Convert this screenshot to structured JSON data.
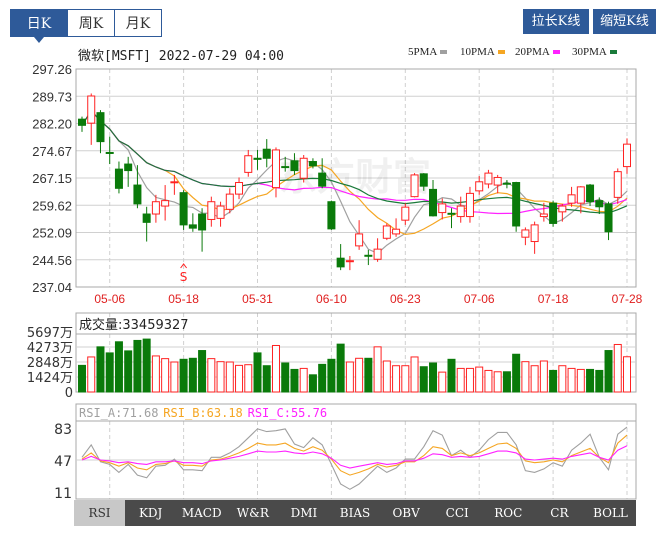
{
  "period_tabs": [
    {
      "label": "日K",
      "active": true
    },
    {
      "label": "周K",
      "active": false
    },
    {
      "label": "月K",
      "active": false
    }
  ],
  "buttons": {
    "stretch": "拉长K线",
    "shrink": "缩短K线"
  },
  "title": "微软[MSFT] 2022-07-29 04:00",
  "watermark": "东方财富",
  "legend": [
    {
      "label": "5PMA",
      "color": "#a0a0a0"
    },
    {
      "label": "10PMA",
      "color": "#f5a623"
    },
    {
      "label": "20PMA",
      "color": "#ff22ff"
    },
    {
      "label": "30PMA",
      "color": "#1a7a3a"
    }
  ],
  "colors": {
    "up": "#ff2222",
    "down": "#0a7a0a",
    "grid": "#d0d0d0",
    "frame": "#a8a8a8",
    "axis_text": "#333333",
    "date_text": "#e02020"
  },
  "signal": {
    "label": "S",
    "index": 11
  },
  "chart_data": [
    {
      "type": "candlestick",
      "title": "微软[MSFT] 2022-07-29 04:00",
      "ylim": [
        237.04,
        297.26
      ],
      "yticks": [
        "297.26",
        "289.73",
        "282.20",
        "274.67",
        "267.15",
        "259.62",
        "252.09",
        "244.56",
        "237.04"
      ],
      "xticks": [
        {
          "label": "05-06",
          "index": 3
        },
        {
          "label": "05-18",
          "index": 11
        },
        {
          "label": "05-31",
          "index": 19
        },
        {
          "label": "06-10",
          "index": 27
        },
        {
          "label": "06-23",
          "index": 35
        },
        {
          "label": "07-06",
          "index": 43
        },
        {
          "label": "07-18",
          "index": 51
        },
        {
          "label": "07-28",
          "index": 59
        }
      ],
      "ma_periods": [
        5,
        10,
        20,
        30
      ],
      "ohlc": [
        [
          283.4,
          284.1,
          279.9,
          281.7
        ],
        [
          282.3,
          290.5,
          276.3,
          289.8
        ],
        [
          285.2,
          285.9,
          274.0,
          277.2
        ],
        [
          274.2,
          278.6,
          271.0,
          274.0
        ],
        [
          269.6,
          271.7,
          262.9,
          264.3
        ],
        [
          271.0,
          273.0,
          264.7,
          269.2
        ],
        [
          265.2,
          270.7,
          258.8,
          260.0
        ],
        [
          257.2,
          259.2,
          249.6,
          254.9
        ],
        [
          257.2,
          262.5,
          254.8,
          260.6
        ],
        [
          259.4,
          265.2,
          255.4,
          260.9
        ],
        [
          265.9,
          268.0,
          262.5,
          266.1
        ],
        [
          263.1,
          263.8,
          252.8,
          254.2
        ],
        [
          254.2,
          257.4,
          252.3,
          253.3
        ],
        [
          257.2,
          258.8,
          246.8,
          252.8
        ],
        [
          255.7,
          262.0,
          253.7,
          260.6
        ],
        [
          256.0,
          260.6,
          253.7,
          259.4
        ],
        [
          258.5,
          264.3,
          257.4,
          262.7
        ],
        [
          262.7,
          267.3,
          261.3,
          265.9
        ],
        [
          268.7,
          274.9,
          267.5,
          273.3
        ],
        [
          272.6,
          274.9,
          269.4,
          272.3
        ],
        [
          275.1,
          277.9,
          270.1,
          272.6
        ],
        [
          264.5,
          275.6,
          261.8,
          274.9
        ],
        [
          270.3,
          273.0,
          268.9,
          270.1
        ],
        [
          271.9,
          274.0,
          268.0,
          269.2
        ],
        [
          267.1,
          273.5,
          265.9,
          272.6
        ],
        [
          271.7,
          272.6,
          269.8,
          270.5
        ],
        [
          268.5,
          272.6,
          264.3,
          264.9
        ],
        [
          260.6,
          260.9,
          252.8,
          253.1
        ],
        [
          245.0,
          248.9,
          241.7,
          242.6
        ],
        [
          244.1,
          245.6,
          241.7,
          244.3
        ],
        [
          248.4,
          255.5,
          247.3,
          251.7
        ],
        [
          245.8,
          247.3,
          243.1,
          245.6
        ],
        [
          244.7,
          250.5,
          244.0,
          247.5
        ],
        [
          250.5,
          254.6,
          250.0,
          253.9
        ],
        [
          251.7,
          256.0,
          250.9,
          253.0
        ],
        [
          255.5,
          260.2,
          254.2,
          259.1
        ],
        [
          262.0,
          268.5,
          261.8,
          268.0
        ],
        [
          268.3,
          268.5,
          263.6,
          264.9
        ],
        [
          264.0,
          266.6,
          256.5,
          256.7
        ],
        [
          257.6,
          261.5,
          255.7,
          260.0
        ],
        [
          257.4,
          258.8,
          253.3,
          257.2
        ],
        [
          256.5,
          262.0,
          254.8,
          259.4
        ],
        [
          256.5,
          264.7,
          254.8,
          262.9
        ],
        [
          263.6,
          267.7,
          262.5,
          266.1
        ],
        [
          265.5,
          269.4,
          264.3,
          268.5
        ],
        [
          265.2,
          268.0,
          262.9,
          267.3
        ],
        [
          265.7,
          266.6,
          264.3,
          265.5
        ],
        [
          265.9,
          266.1,
          252.3,
          253.9
        ],
        [
          250.8,
          253.5,
          248.6,
          252.8
        ],
        [
          249.6,
          255.1,
          246.2,
          254.2
        ],
        [
          256.5,
          260.3,
          255.1,
          257.2
        ],
        [
          260.2,
          260.9,
          253.7,
          254.6
        ],
        [
          257.8,
          260.0,
          255.1,
          259.4
        ],
        [
          260.2,
          264.7,
          259.2,
          262.5
        ],
        [
          260.2,
          264.9,
          257.4,
          264.7
        ],
        [
          265.2,
          265.5,
          259.4,
          260.6
        ],
        [
          260.9,
          261.8,
          257.2,
          259.2
        ],
        [
          260.0,
          260.6,
          250.0,
          252.3
        ],
        [
          261.8,
          269.8,
          260.0,
          268.9
        ],
        [
          270.3,
          278.1,
          268.3,
          276.5
        ]
      ]
    },
    {
      "type": "bar",
      "title": "成交量",
      "label": "成交量:33459327",
      "unit": "万",
      "ylim": [
        0,
        5697
      ],
      "yticks": [
        "5697万",
        "4273万",
        "2848万",
        "1424万",
        "0"
      ],
      "values": [
        2528,
        3328,
        4288,
        3712,
        4768,
        3904,
        4896,
        5024,
        3424,
        3168,
        2848,
        3104,
        3200,
        3936,
        3168,
        2880,
        2848,
        2528,
        2592,
        3712,
        2496,
        4416,
        2752,
        2144,
        2240,
        1632,
        2624,
        3104,
        4544,
        2848,
        3200,
        3200,
        4288,
        2944,
        2496,
        2496,
        3328,
        2400,
        2752,
        1888,
        3104,
        2240,
        2240,
        2368,
        2048,
        1920,
        1920,
        3584,
        2880,
        2496,
        2944,
        2048,
        2496,
        2240,
        2144,
        2144,
        2048,
        3936,
        4512,
        3346
      ]
    },
    {
      "type": "line",
      "title": "RSI",
      "ylim": [
        11,
        83
      ],
      "yticks": [
        "83",
        "47",
        "11"
      ],
      "series": [
        {
          "name": "RSI_A",
          "label": "RSI_A:71.68",
          "color": "#a0a0a0",
          "values": [
            50,
            64,
            45,
            42,
            33,
            42,
            30,
            27,
            40,
            41,
            48,
            36,
            36,
            35,
            50,
            50,
            55,
            62,
            72,
            82,
            79,
            80,
            82,
            65,
            61,
            72,
            64,
            42,
            20,
            14,
            20,
            30,
            40,
            33,
            38,
            48,
            48,
            62,
            80,
            75,
            52,
            58,
            50,
            58,
            70,
            78,
            78,
            64,
            35,
            33,
            37,
            44,
            40,
            58,
            66,
            76,
            50,
            36,
            76,
            84
          ]
        },
        {
          "name": "RSI_B",
          "label": "RSI_B:63.18",
          "color": "#f5a623",
          "values": [
            48,
            55,
            46,
            44,
            40,
            44,
            38,
            36,
            42,
            43,
            46,
            41,
            41,
            40,
            47,
            48,
            51,
            55,
            60,
            66,
            64,
            64,
            66,
            60,
            57,
            62,
            58,
            48,
            35,
            30,
            33,
            37,
            42,
            39,
            41,
            45,
            45,
            52,
            62,
            60,
            52,
            55,
            52,
            55,
            60,
            65,
            66,
            60,
            46,
            44,
            45,
            47,
            45,
            52,
            56,
            60,
            50,
            44,
            66,
            75
          ]
        },
        {
          "name": "RSI_C",
          "label": "RSI_C:55.76",
          "color": "#ff22ff",
          "values": [
            47,
            51,
            47,
            46,
            44,
            45,
            43,
            42,
            45,
            45,
            46,
            44,
            44,
            43,
            46,
            47,
            49,
            51,
            54,
            57,
            56,
            56,
            57,
            55,
            54,
            56,
            54,
            49,
            41,
            38,
            40,
            42,
            44,
            42,
            43,
            46,
            46,
            49,
            54,
            53,
            50,
            51,
            50,
            51,
            54,
            57,
            57,
            55,
            48,
            47,
            48,
            49,
            48,
            51,
            53,
            55,
            50,
            47,
            58,
            63
          ]
        }
      ]
    }
  ],
  "indicator_tabs": [
    {
      "label": "RSI",
      "active": true
    },
    {
      "label": "KDJ"
    },
    {
      "label": "MACD"
    },
    {
      "label": "W&R"
    },
    {
      "label": "DMI"
    },
    {
      "label": "BIAS"
    },
    {
      "label": "OBV"
    },
    {
      "label": "CCI"
    },
    {
      "label": "ROC"
    },
    {
      "label": "CR"
    },
    {
      "label": "BOLL"
    }
  ]
}
